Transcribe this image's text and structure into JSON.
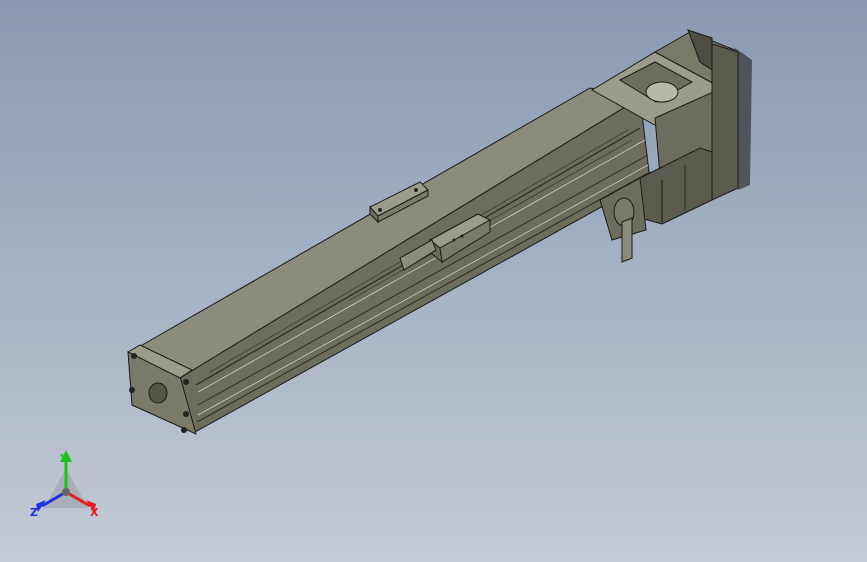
{
  "viewport": {
    "background_top": "#8a9ab2",
    "background_bottom": "#c4cad6",
    "model_color": "#6d6d5e",
    "edge_color": "#1a1a1a"
  },
  "triad": {
    "x_label": "X",
    "y_label": "Y",
    "z_label": "Z",
    "x_color": "#e02020",
    "y_color": "#20c020",
    "z_color": "#2030e0"
  }
}
